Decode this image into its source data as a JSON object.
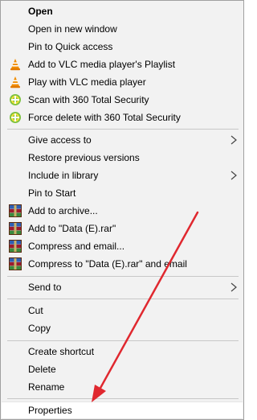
{
  "menu": {
    "items": [
      {
        "label": "Open",
        "icon": "none",
        "bold": true
      },
      {
        "label": "Open in new window",
        "icon": "none"
      },
      {
        "label": "Pin to Quick access",
        "icon": "none"
      },
      {
        "label": "Add to VLC media player's Playlist",
        "icon": "vlc-cone-icon"
      },
      {
        "label": "Play with VLC media player",
        "icon": "vlc-cone-icon"
      },
      {
        "label": "Scan with 360 Total Security",
        "icon": "360-security-icon"
      },
      {
        "label": "Force delete with 360 Total Security",
        "icon": "360-security-icon"
      },
      {
        "label": "Give access to",
        "icon": "none",
        "submenu": true
      },
      {
        "label": "Restore previous versions",
        "icon": "none"
      },
      {
        "label": "Include in library",
        "icon": "none",
        "submenu": true
      },
      {
        "label": "Pin to Start",
        "icon": "none"
      },
      {
        "label": "Add to archive...",
        "icon": "winrar-icon"
      },
      {
        "label": "Add to \"Data (E).rar\"",
        "icon": "winrar-icon"
      },
      {
        "label": "Compress and email...",
        "icon": "winrar-icon"
      },
      {
        "label": "Compress to \"Data (E).rar\" and email",
        "icon": "winrar-icon"
      },
      {
        "label": "Send to",
        "icon": "none",
        "submenu": true
      },
      {
        "label": "Cut",
        "icon": "none"
      },
      {
        "label": "Copy",
        "icon": "none"
      },
      {
        "label": "Create shortcut",
        "icon": "none"
      },
      {
        "label": "Delete",
        "icon": "none"
      },
      {
        "label": "Rename",
        "icon": "none"
      },
      {
        "label": "Properties",
        "icon": "none",
        "highlighted": true
      }
    ]
  },
  "colors": {
    "menu_bg": "#f2f2f2",
    "hover_bg": "#ffffff",
    "separator": "#c8c8c8",
    "annotation_arrow": "#e0282f",
    "vlc_orange": "#f08c00",
    "security_green": "#7cc242",
    "winrar_red": "#9c1b2e"
  }
}
